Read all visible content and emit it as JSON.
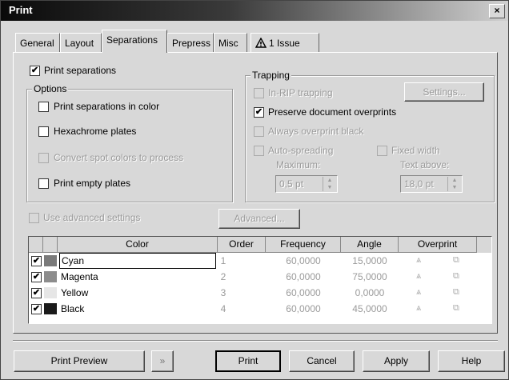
{
  "window": {
    "title": "Print",
    "close": "×"
  },
  "tabs": [
    {
      "label": "General"
    },
    {
      "label": "Layout"
    },
    {
      "label": "Separations"
    },
    {
      "label": "Prepress"
    },
    {
      "label": "Misc"
    },
    {
      "label": "1 Issue"
    }
  ],
  "left": {
    "print_separations": "Print separations",
    "options_label": "Options",
    "in_color": "Print separations in color",
    "hexachrome": "Hexachrome plates",
    "convert_spot": "Convert spot colors to process",
    "empty_plates": "Print empty plates",
    "advanced_settings": "Use advanced settings",
    "advanced_btn": "Advanced..."
  },
  "trapping": {
    "label": "Trapping",
    "in_rip": "In-RIP trapping",
    "settings_btn": "Settings...",
    "preserve": "Preserve document overprints",
    "always_black": "Always overprint black",
    "auto_spreading": "Auto-spreading",
    "fixed_width": "Fixed width",
    "maximum_label": "Maximum:",
    "maximum_value": "0,5 pt",
    "text_above_label": "Text above:",
    "text_above_value": "18,0 pt"
  },
  "table": {
    "headers": {
      "color": "Color",
      "order": "Order",
      "frequency": "Frequency",
      "angle": "Angle",
      "overprint": "Overprint"
    },
    "rows": [
      {
        "name": "Cyan",
        "order": "1",
        "frequency": "60,0000",
        "angle": "15,0000",
        "swatch": "#7a7a7a"
      },
      {
        "name": "Magenta",
        "order": "2",
        "frequency": "60,0000",
        "angle": "75,0000",
        "swatch": "#8c8c8c"
      },
      {
        "name": "Yellow",
        "order": "3",
        "frequency": "60,0000",
        "angle": "0,0000",
        "swatch": "#e6e6e6"
      },
      {
        "name": "Black",
        "order": "4",
        "frequency": "60,0000",
        "angle": "45,0000",
        "swatch": "#1a1a1a"
      }
    ]
  },
  "footer": {
    "print_preview": "Print Preview",
    "collapse": "»",
    "print": "Print",
    "cancel": "Cancel",
    "apply": "Apply",
    "help": "Help"
  }
}
